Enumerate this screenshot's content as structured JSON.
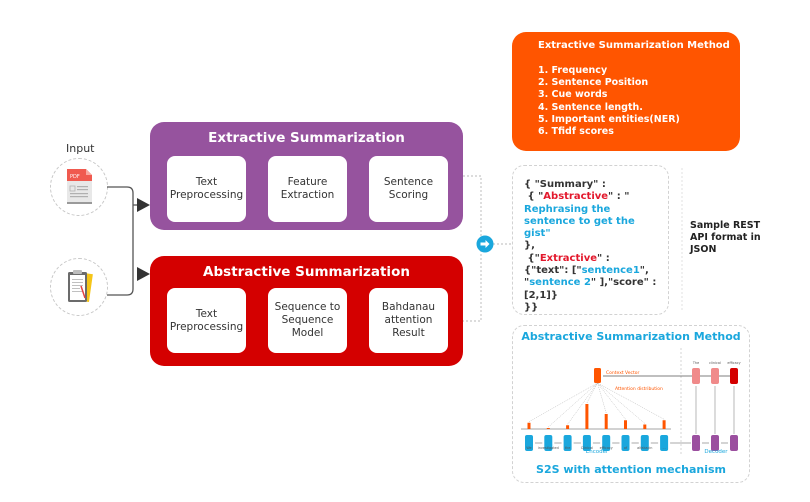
{
  "input": {
    "label": "Input",
    "pdf_badge": "PDF"
  },
  "extractive": {
    "title": "Extractive Summarization",
    "steps": [
      "Text\nPreprocessing",
      "Feature\nExtraction",
      "Sentence\nScoring"
    ]
  },
  "abstractive": {
    "title": "Abstractive Summarization",
    "steps": [
      "Text\nPreprocessing",
      "Sequence to\nSequence\nModel",
      "Bahdanau\nattention\nResult"
    ]
  },
  "extractive_method": {
    "title": "Extractive Summarization Method",
    "items": [
      "1.  Frequency",
      "2. Sentence Position",
      "3. Cue words",
      "4. Sentence length.",
      "5. Important entities(NER)",
      "6. Tfidf scores"
    ]
  },
  "json_sample": {
    "line1": "{ \"Summary\" :",
    "line2_pre": " { \"",
    "abstractive_key": "Abstractive",
    "line2_post": "\" : \"",
    "abstractive_value": "Rephrasing the sentence to get the gist\"",
    "line4": "},",
    "line5_pre": " {\"",
    "extractive_key": "Extractive",
    "line5_post": "\" :",
    "line6_pre": "{\"text\": [\"",
    "sentence1": "sentence1",
    "line6_post": "\",",
    "line7_pre": "\"",
    "sentence2": "sentence 2",
    "line7_post": "\" ],\"score\" :",
    "line8": "[2,1]}",
    "line9": "}}"
  },
  "rest_label": "Sample REST API format in JSON",
  "abstractive_method": {
    "title": "Abstractive Summarization Method",
    "context_vector_label": "Context Vector",
    "attention_label": "Attention distribution",
    "encoder_words": [
      "We",
      "investigated",
      "the",
      "Clinical",
      "efficacy",
      "of",
      "alfakacin",
      "..."
    ],
    "attention_weights": [
      0.25,
      0.03,
      0.15,
      1.0,
      0.6,
      0.35,
      0.18,
      0.35
    ],
    "decoder_words": [
      "The",
      "clinical",
      "efficacy"
    ],
    "encoder_label": "Encoder",
    "decoder_label": "Decoder",
    "footer": "S2S with attention mechanism"
  },
  "colors": {
    "extractive": "#96539e",
    "abstractive": "#d40000",
    "orange": "#ff5500",
    "blue": "#1aa7dd",
    "decoder_cell": "#9b4f9f"
  }
}
